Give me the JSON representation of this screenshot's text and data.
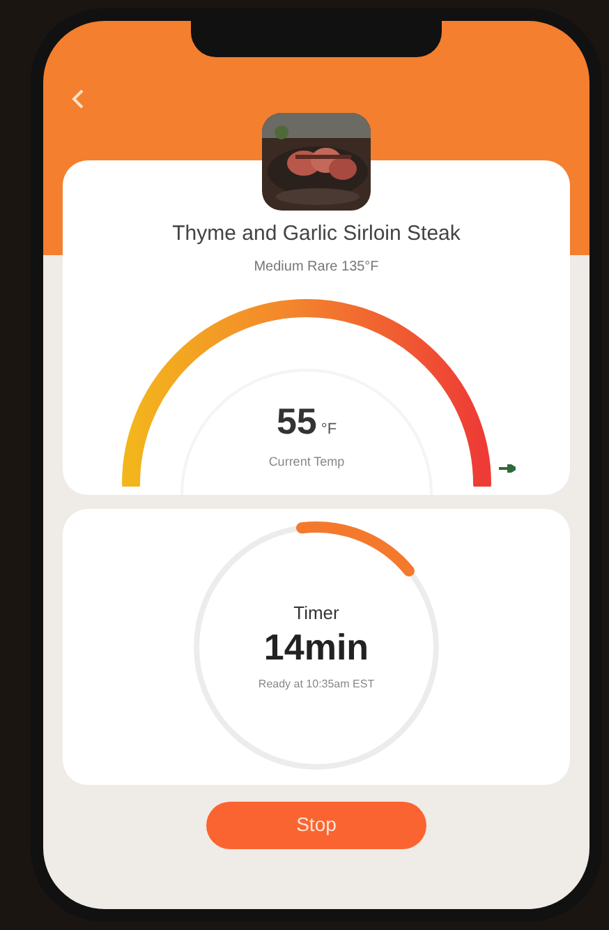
{
  "recipe": {
    "title": "Thyme and Garlic Sirloin Steak",
    "doneness": "Medium Rare 135°F"
  },
  "temperature": {
    "reading": "55",
    "unit": "°F",
    "label": "Current Temp"
  },
  "timer": {
    "title": "Timer",
    "remaining": "14min",
    "ready_text": "Ready at 10:35am EST",
    "level": 0.16
  },
  "button": "Stop"
}
